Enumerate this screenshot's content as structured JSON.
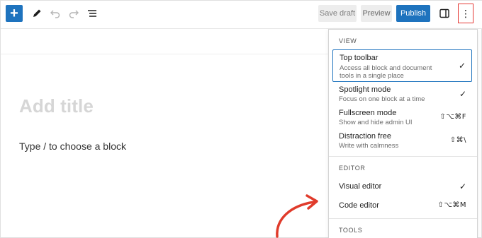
{
  "toolbar": {
    "add_symbol": "+",
    "save_draft_label": "Save draft",
    "preview_label": "Preview",
    "publish_label": "Publish",
    "kebab_symbol": "⋮"
  },
  "editor": {
    "title_placeholder": "Add title",
    "block_placeholder": "Type / to choose a block"
  },
  "menu": {
    "view_label": "VIEW",
    "view_items": [
      {
        "title": "Top toolbar",
        "desc1": "Access all block and document",
        "desc2": "tools in a single place",
        "indicator": "✓",
        "active": true
      },
      {
        "title": "Spotlight mode",
        "desc1": "Focus on one block at a time",
        "indicator": "✓"
      },
      {
        "title": "Fullscreen mode",
        "desc1": "Show and hide admin UI",
        "indicator": "⇧⌥⌘F"
      },
      {
        "title": "Distraction free",
        "desc1": "Write with calmness",
        "indicator": "⇧⌘\\"
      }
    ],
    "editor_label": "EDITOR",
    "editor_items": [
      {
        "title": "Visual editor",
        "indicator": "✓"
      },
      {
        "title": "Code editor",
        "indicator": "⇧⌥⌘M"
      }
    ],
    "tools_label": "TOOLS"
  },
  "colors": {
    "accent": "#1e73be",
    "highlight_box": "#e53935",
    "arrow": "#e03b2b"
  }
}
